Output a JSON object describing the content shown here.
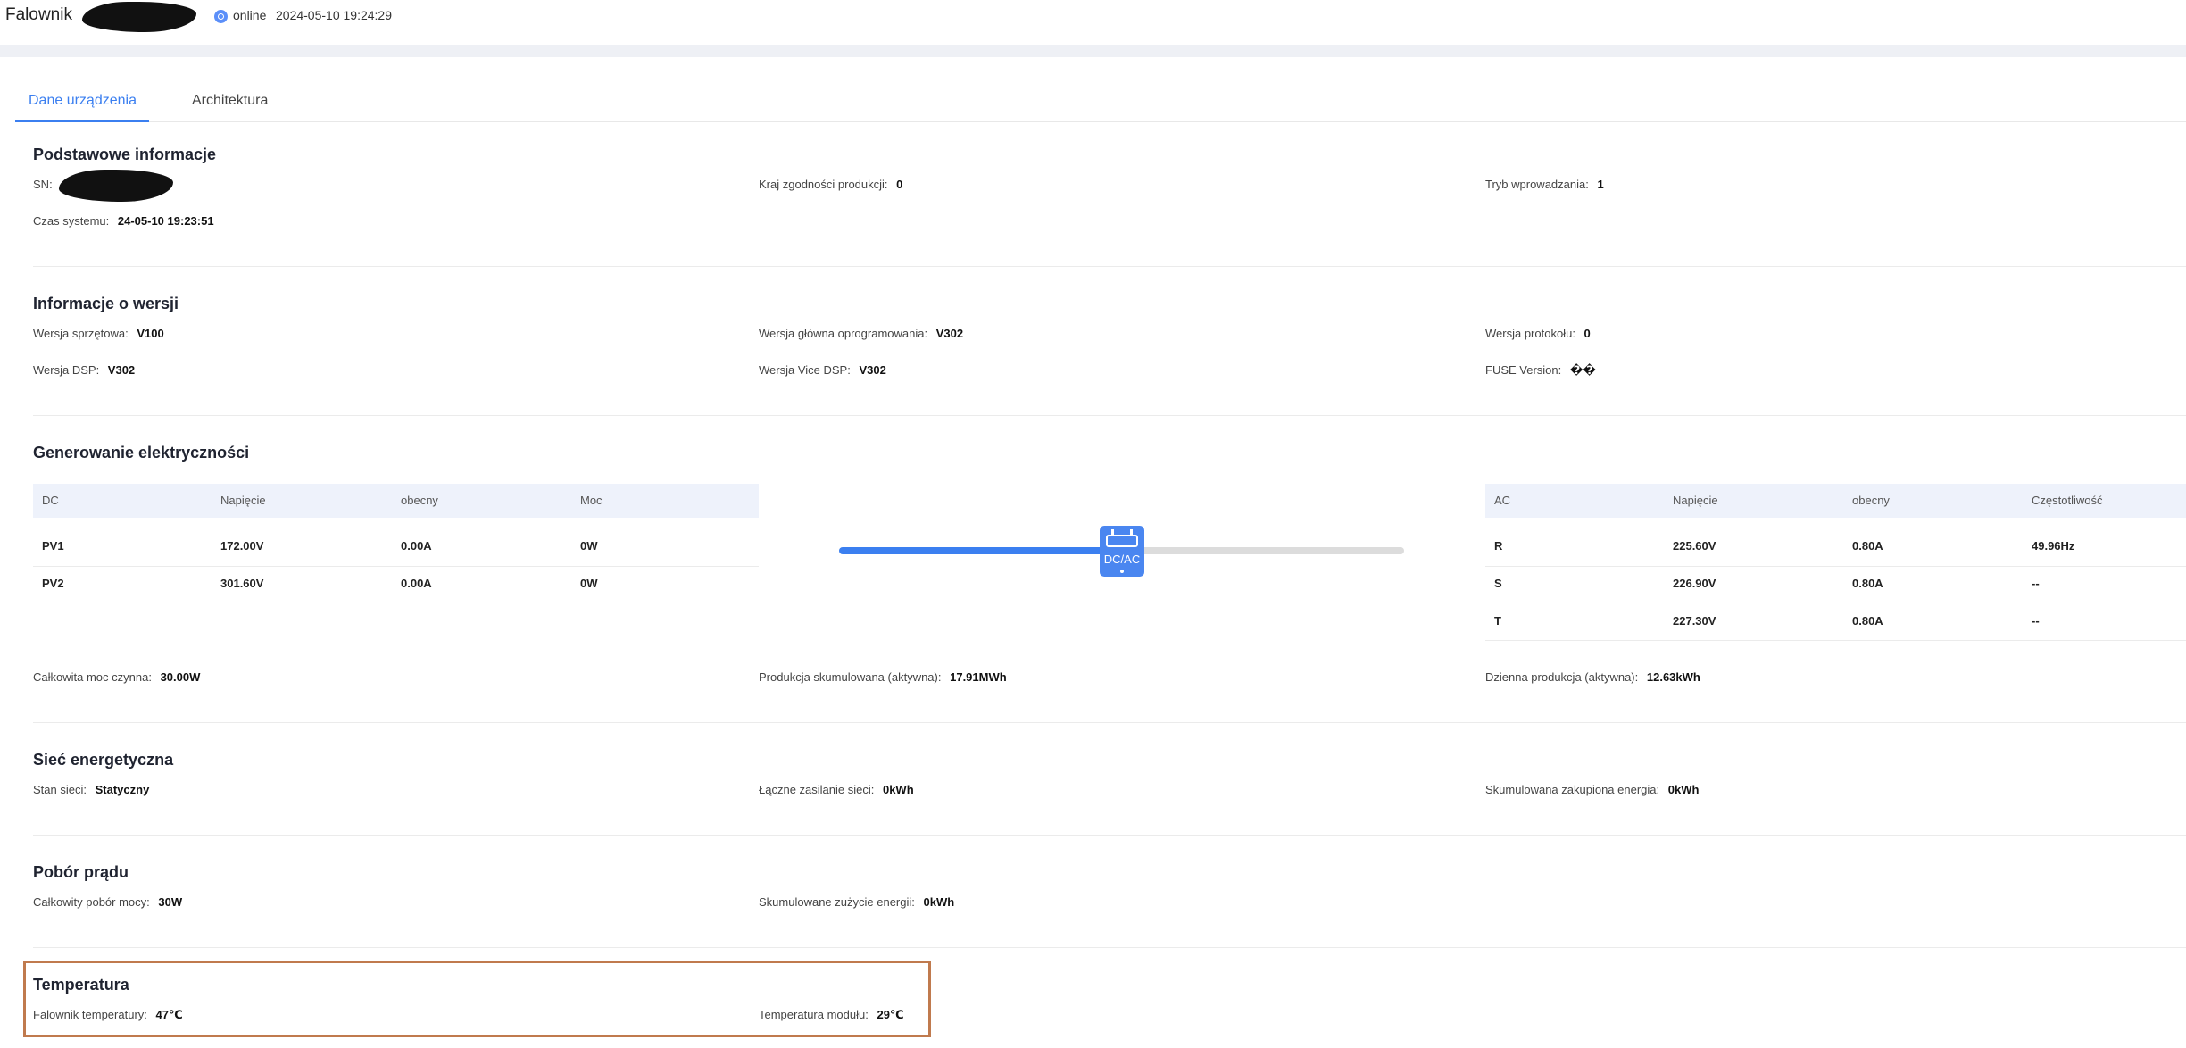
{
  "header": {
    "title": "Falownik",
    "status": "online",
    "timestamp": "2024-05-10 19:24:29"
  },
  "tabs": [
    {
      "label": "Dane urządzenia",
      "active": true
    },
    {
      "label": "Architektura",
      "active": false
    }
  ],
  "basic": {
    "title": "Podstawowe informacje",
    "sn_label": "SN",
    "country_label": "Kraj zgodności produkcji",
    "country_value": "0",
    "input_mode_label": "Tryb wprowadzania",
    "input_mode_value": "1",
    "system_time_label": "Czas systemu",
    "system_time_value": "24-05-10 19:23:51"
  },
  "version": {
    "title": "Informacje o wersji",
    "hw_label": "Wersja sprzętowa",
    "hw_value": "V100",
    "main_sw_label": "Wersja główna oprogramowania",
    "main_sw_value": "V302",
    "protocol_label": "Wersja protokołu",
    "protocol_value": "0",
    "dsp_label": "Wersja DSP",
    "dsp_value": "V302",
    "vice_dsp_label": "Wersja Vice DSP",
    "vice_dsp_value": "V302",
    "fuse_label": "FUSE Version",
    "fuse_value": "��"
  },
  "generation": {
    "title": "Generowanie elektryczności",
    "dc_headers": [
      "DC",
      "Napięcie",
      "obecny",
      "Moc"
    ],
    "dc_rows": [
      [
        "PV1",
        "172.00V",
        "0.00A",
        "0W"
      ],
      [
        "PV2",
        "301.60V",
        "0.00A",
        "0W"
      ]
    ],
    "converter_label": "DC/AC",
    "ac_headers": [
      "AC",
      "Napięcie",
      "obecny",
      "Częstotliwość"
    ],
    "ac_rows": [
      [
        "R",
        "225.60V",
        "0.80A",
        "49.96Hz"
      ],
      [
        "S",
        "226.90V",
        "0.80A",
        "--"
      ],
      [
        "T",
        "227.30V",
        "0.80A",
        "--"
      ]
    ],
    "total_power_label": "Całkowita moc czynna",
    "total_power_value": "30.00W",
    "cumulative_label": "Produkcja skumulowana (aktywna)",
    "cumulative_value": "17.91MWh",
    "daily_label": "Dzienna produkcja (aktywna)",
    "daily_value": "12.63kWh"
  },
  "grid": {
    "title": "Sieć energetyczna",
    "state_label": "Stan sieci",
    "state_value": "Statyczny",
    "total_feed_label": "Łączne zasilanie sieci",
    "total_feed_value": "0kWh",
    "purchased_label": "Skumulowana zakupiona energia",
    "purchased_value": "0kWh"
  },
  "consumption": {
    "title": "Pobór prądu",
    "total_label": "Całkowity pobór mocy",
    "total_value": "30W",
    "cumulative_label": "Skumulowane zużycie energii",
    "cumulative_value": "0kWh"
  },
  "temperature": {
    "title": "Temperatura",
    "inverter_label": "Falownik temperatury",
    "inverter_value": "47℃",
    "module_label": "Temperatura modułu",
    "module_value": "29℃"
  },
  "colors": {
    "accent": "#3b7ff0",
    "highlight_border": "#c07a4e"
  }
}
